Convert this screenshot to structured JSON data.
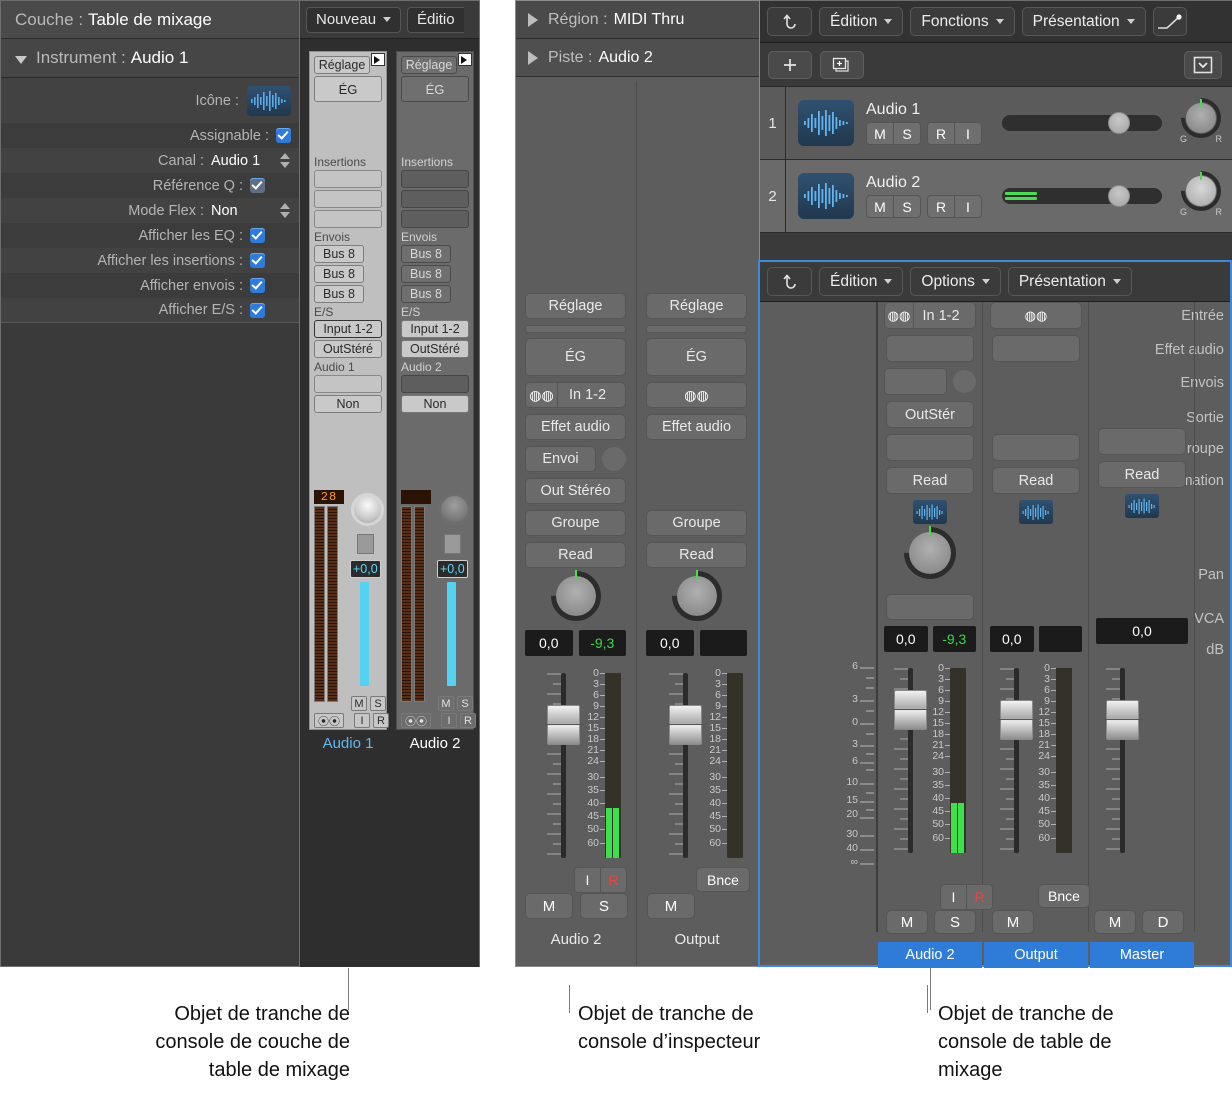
{
  "layer_inspector": {
    "header": {
      "label": "Couche :",
      "value": "Table de mixage"
    },
    "subheader": {
      "label": "Instrument :",
      "value": "Audio 1"
    },
    "rows": [
      {
        "label": "Icône :",
        "type": "icon",
        "icon": "audio-waveform-icon"
      },
      {
        "label": "Assignable :",
        "type": "check",
        "checked": true
      },
      {
        "label": "Canal :",
        "type": "popup",
        "value": "Audio 1"
      },
      {
        "label": "Référence Q :",
        "type": "check_dim",
        "checked": true
      },
      {
        "label": "Mode Flex :",
        "type": "popup",
        "value": "Non"
      },
      {
        "label": "Afficher les EQ :",
        "type": "check",
        "checked": true
      },
      {
        "label": "Afficher les insertions :",
        "type": "check",
        "checked": true
      },
      {
        "label": "Afficher envois :",
        "type": "check",
        "checked": true
      },
      {
        "label": "Afficher E/S :",
        "type": "check",
        "checked": true
      }
    ]
  },
  "layer_mixer": {
    "menus": [
      "Nouveau",
      "Éditio"
    ],
    "strips": [
      {
        "name": "Audio 1",
        "selected": true,
        "setting": "Réglage",
        "eq": "ÉG",
        "inserts_label": "Insertions",
        "inserts": [
          "",
          "",
          ""
        ],
        "sends_label": "Envois",
        "sends": [
          "Bus 8",
          "Bus 8",
          "Bus 8"
        ],
        "io_label": "E/S",
        "input": "Input 1-2",
        "output": "OutStéré",
        "track_name": "Audio 1",
        "group": "",
        "automation": "Non",
        "led": "28",
        "fader_db": "+0,0",
        "mute": "M",
        "solo": "S",
        "stereo_icon": "stereo-link-icon",
        "input_btn": "I",
        "rec_btn": "R"
      },
      {
        "name": "Audio 2",
        "selected": false,
        "setting": "Réglage",
        "eq": "ÉG",
        "inserts_label": "Insertions",
        "inserts": [
          "",
          "",
          ""
        ],
        "sends_label": "Envois",
        "sends": [
          "Bus 8",
          "Bus 8",
          "Bus 8"
        ],
        "io_label": "E/S",
        "input": "Input 1-2",
        "output": "OutStéré",
        "track_name": "Audio 2",
        "group": "",
        "automation": "Non",
        "led": "",
        "fader_db": "+0,0",
        "mute": "M",
        "solo": "S",
        "stereo_icon": "stereo-link-icon",
        "input_btn": "I",
        "rec_btn": "R"
      }
    ]
  },
  "inspector": {
    "region": {
      "label": "Région :",
      "value": "MIDI Thru"
    },
    "track": {
      "label": "Piste :",
      "value": "Audio 2"
    },
    "strips": [
      {
        "name": "Audio 2",
        "setting": "Réglage",
        "eq": "ÉG",
        "input": "In 1-2",
        "input_icon": "stereo-link-icon",
        "audio_fx": "Effet audio",
        "send": "Envoi",
        "output": "Out Stéréo",
        "group": "Groupe",
        "automation": "Read",
        "pan_db": "0,0",
        "volume_db": "-9,3",
        "mute": "M",
        "solo": "S",
        "input_monitor": "I",
        "record": "R",
        "meter_level_db": -44
      },
      {
        "name": "Output",
        "setting": "Réglage",
        "eq": "ÉG",
        "input": "",
        "input_icon": "stereo-link-icon",
        "audio_fx": "Effet audio",
        "send": "",
        "output": "",
        "group": "Groupe",
        "automation": "Read",
        "pan_db": "0,0",
        "volume_db": "",
        "mute": "M",
        "bounce": "Bnce",
        "meter_level_db": null
      }
    ],
    "scale_ticks": [
      "0",
      "3",
      "6",
      "9",
      "12",
      "15",
      "18",
      "21",
      "24",
      "30",
      "35",
      "40",
      "45",
      "50",
      "60"
    ]
  },
  "track_area": {
    "toolbar": {
      "back_icon": "undo-arrow-icon",
      "menus": [
        "Édition",
        "Fonctions",
        "Présentation"
      ],
      "automation_icon": "automation-curve-icon"
    },
    "subtoolbar": {
      "add_icon": "plus-icon",
      "duplicate_icon": "duplicate-track-icon",
      "disclosure_icon": "chevron-down-box-icon"
    },
    "tracks": [
      {
        "number": "1",
        "name": "Audio 1",
        "icon": "audio-waveform-icon",
        "mute": "M",
        "solo": "S",
        "record": "R",
        "input": "I",
        "volume_pos_pct": 70,
        "level_pct": 0,
        "pan_left": "G",
        "pan_right": "R"
      },
      {
        "number": "2",
        "name": "Audio 2",
        "icon": "audio-waveform-icon",
        "mute": "M",
        "solo": "S",
        "record": "R",
        "input": "I",
        "volume_pos_pct": 70,
        "level_pct": 21,
        "pan_left": "G",
        "pan_right": "R"
      }
    ]
  },
  "mixer": {
    "toolbar": {
      "back_icon": "undo-arrow-icon",
      "menus": [
        "Édition",
        "Options",
        "Présentation"
      ]
    },
    "row_labels": [
      "Entrée",
      "Effet audio",
      "Envois",
      "Sortie",
      "Groupe",
      "Automation",
      "Pan",
      "VCA",
      "dB"
    ],
    "scale_ticks": [
      "6",
      "3",
      "0",
      "3",
      "6",
      "10",
      "15",
      "20",
      "30",
      "40",
      "∞"
    ],
    "meter_ticks": [
      "0",
      "3",
      "6",
      "9",
      "12",
      "15",
      "18",
      "21",
      "24",
      "30",
      "35",
      "40",
      "45",
      "50",
      "60"
    ],
    "strips": [
      {
        "name": "Audio 2",
        "input": "In 1-2",
        "input_icon": "stereo-link-icon",
        "audio_fx": "",
        "sends": "",
        "output": "OutStér",
        "group": "",
        "automation": "Read",
        "icon": "audio-waveform-icon",
        "has_pan": true,
        "vca": "",
        "pan_db": "0,0",
        "volume_db": "-9,3",
        "mute": "M",
        "solo": "S",
        "input_monitor": "I",
        "record": "R",
        "meter_level_db": -44,
        "selected": true
      },
      {
        "name": "Output",
        "input": "",
        "input_icon": "stereo-link-icon",
        "audio_fx": "",
        "sends": "",
        "output": "",
        "group": "",
        "automation": "Read",
        "icon": "audio-waveform-icon",
        "has_pan": true,
        "vca": "",
        "pan_db": "0,0",
        "volume_db": "",
        "mute": "M",
        "bounce": "Bnce",
        "meter_level_db": null,
        "selected": true
      },
      {
        "name": "Master",
        "input": "",
        "audio_fx": "",
        "sends": "",
        "output": "",
        "group": "",
        "automation": "Read",
        "icon": "audio-waveform-icon",
        "has_pan": false,
        "vca": "",
        "volume_db": "0,0",
        "mute": "M",
        "dim": "D",
        "meter_level_db": null,
        "selected": true
      }
    ]
  },
  "captions": [
    {
      "lines": [
        "Objet de tranche de",
        "console de couche de",
        "table de mixage"
      ]
    },
    {
      "lines": [
        "Objet de tranche de",
        "console d’inspecteur"
      ]
    },
    {
      "lines": [
        "Objet de tranche de",
        "console de table de",
        "mixage"
      ]
    }
  ],
  "colors": {
    "accent_blue": "#2f7bd8",
    "selection_border": "#3f8ad8",
    "meter_green": "#37d84a",
    "fader_cyan": "#53d2f2",
    "led_orange": "#ff9a20",
    "record_red": "#e8453c"
  }
}
